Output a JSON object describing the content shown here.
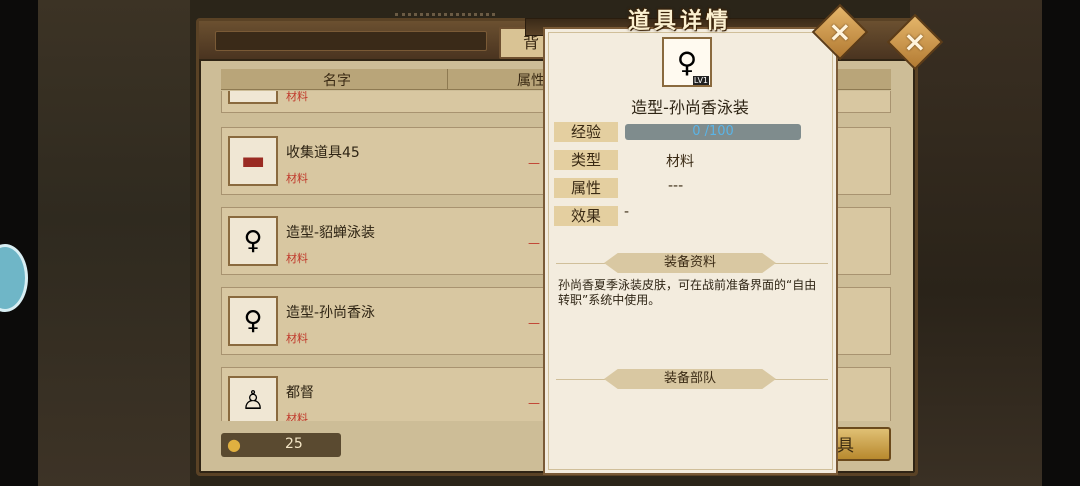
{
  "inventory": {
    "column_name": "名字",
    "column_attr": "属性",
    "tab_partial": "背",
    "items": [
      {
        "name": "",
        "type": "材料",
        "icon": "item-icon"
      },
      {
        "name": "收集道具45",
        "type": "材料",
        "icon": "tank-icon"
      },
      {
        "name": "造型-貂蝉泳装",
        "type": "材料",
        "icon": "swimsuit-character-icon"
      },
      {
        "name": "造型-孙尚香泳",
        "type": "材料",
        "icon": "swimsuit-character-icon"
      },
      {
        "name": "都督",
        "type": "材料",
        "icon": "general-character-icon"
      }
    ],
    "row_dash": "—",
    "coins": "25",
    "bottom_button": "具"
  },
  "detail": {
    "title": "道具详情",
    "item_name": "造型-孙尚香泳装",
    "portrait_tag": "LV1",
    "exp_label": "经验",
    "exp_value": "0 /100",
    "exp_progress": 0.0,
    "type_label": "类型",
    "type_value": "材料",
    "attr_label": "属性",
    "attr_value": "---",
    "effect_label": "效果",
    "effect_value": "-",
    "info_section": "装备资料",
    "description": "孙尚香夏季泳装皮肤，可在战前准备界面的“自由转职”系统中使用。",
    "troop_section": "装备部队"
  }
}
